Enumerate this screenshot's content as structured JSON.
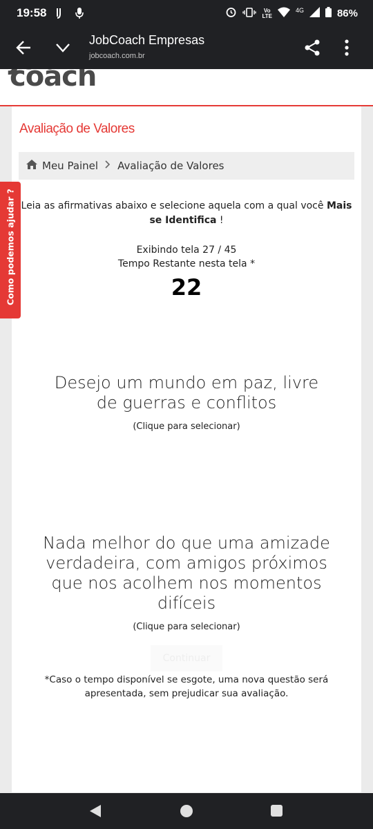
{
  "status_bar": {
    "time": "19:58",
    "network": "4G",
    "lte_top": "Vo",
    "lte_bottom": "LTE",
    "battery": "86%"
  },
  "browser": {
    "title": "JobCoach Empresas",
    "url": "jobcoach.com.br"
  },
  "site": {
    "logo_text": "coach"
  },
  "page": {
    "title": "Avaliação de Valores",
    "breadcrumb": {
      "home": "Meu Painel",
      "current": "Avaliação de Valores"
    },
    "instructions_prefix": "Leia as afirmativas abaixo e selecione aquela com a qual você ",
    "instructions_bold": "Mais se Identifica",
    "instructions_suffix": " !",
    "screen_counter": "Exibindo tela 27 / 45",
    "time_label": "Tempo Restante nesta tela *",
    "timer_value": "22",
    "options": [
      {
        "text": "Desejo um mundo em paz, livre de guerras e conflitos",
        "hint": "(Clique para selecionar)"
      },
      {
        "text": "Nada melhor do que uma amizade verdadeira, com amigos próximos que nos acolhem nos momentos difíceis",
        "hint": "(Clique para selecionar)"
      }
    ],
    "continue_label": "Continuar",
    "footnote": "*Caso o tempo disponível se esgote, uma nova questão será apresentada, sem prejudicar sua avaliação."
  },
  "help_tab": {
    "label": "Como podemos ajudar ?"
  }
}
